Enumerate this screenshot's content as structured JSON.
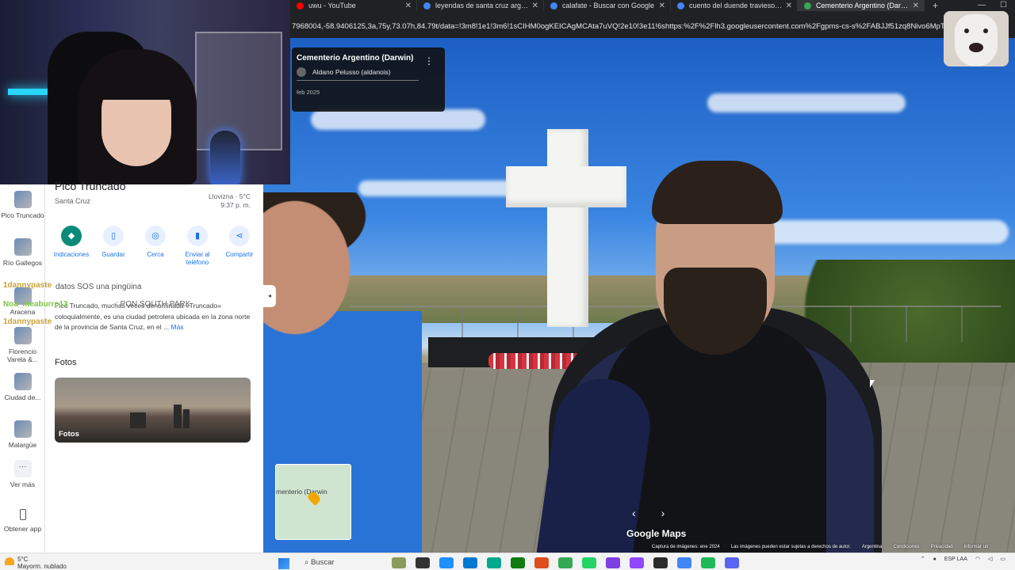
{
  "browser": {
    "tabs": [
      {
        "title": "uwu - YouTube",
        "color": "#ff0000",
        "active": false
      },
      {
        "title": "leyendas de santa cruz argentina",
        "color": "#4285f4",
        "active": false
      },
      {
        "title": "calafate - Buscar con Google",
        "color": "#4285f4",
        "active": false
      },
      {
        "title": "cuento del duende travieso - B",
        "color": "#4285f4",
        "active": false
      },
      {
        "title": "Cementerio Argentino (Darwin)",
        "color": "#34a853",
        "active": true
      }
    ],
    "url": "7968004,-58.9406125,3a,75y,73.07h,84.79t/data=!3m8!1e1!3m6!1sCIHM0ogKEICAgMCAta7uVQ!2e10!3e11!6shttps:%2F%2Flh3.googleusercontent.com%2Fgpms-cs-s%2FABJJf51zq8Nivo6MpT..."
  },
  "streetview": {
    "title": "Cementerio Argentino (Darwin)",
    "author": "Aldano Pelusso (aldanois)",
    "date": "feb 2025",
    "minimap_label": "menterio (Darwin",
    "logo": "Google Maps",
    "attribution": [
      "Captura de imágenes: ene 2024",
      "Las imágenes pueden estar sujetas a derechos de autor.",
      "Argentina",
      "Condiciones",
      "Privacidad",
      "Informar un"
    ]
  },
  "rail": [
    {
      "label": "Pico Truncado"
    },
    {
      "label": "Río Gallegos"
    },
    {
      "label": "Aracena"
    },
    {
      "label": "Florencio Varela &..."
    },
    {
      "label": "Ciudad de..."
    },
    {
      "label": "Malargüe"
    },
    {
      "label": "Ver más"
    },
    {
      "label": "Obtener app"
    }
  ],
  "place": {
    "title": "Pico Truncado",
    "subtitle": "Santa Cruz",
    "weather": "Llovizna · 5°C",
    "time": "9:37 p. m.",
    "actions": [
      "Indicaciones",
      "Guardar",
      "Cerca",
      "Enviar al teléfono",
      "Compartir"
    ],
    "description": "Pico Truncado, muchas veces denominada «Truncado» coloquialmente, es una ciudad petrolera ubicada en la zona norte de la provincia de Santa Cruz, en el ...",
    "more": "Más",
    "photos_heading": "Fotos",
    "photos_label": "Fotos"
  },
  "chat": {
    "user1": "1dannypaste",
    "msg1": "datos SOS una pingüina",
    "user2": "Noa_meaburro13",
    "msg2": ": PON SOUTH PARK",
    "user3": "1dannypaste"
  },
  "taskbar": {
    "temp": "5°C",
    "condition": "Mayorm. nublado",
    "search": "Buscar",
    "lang": "ESP LAA"
  }
}
